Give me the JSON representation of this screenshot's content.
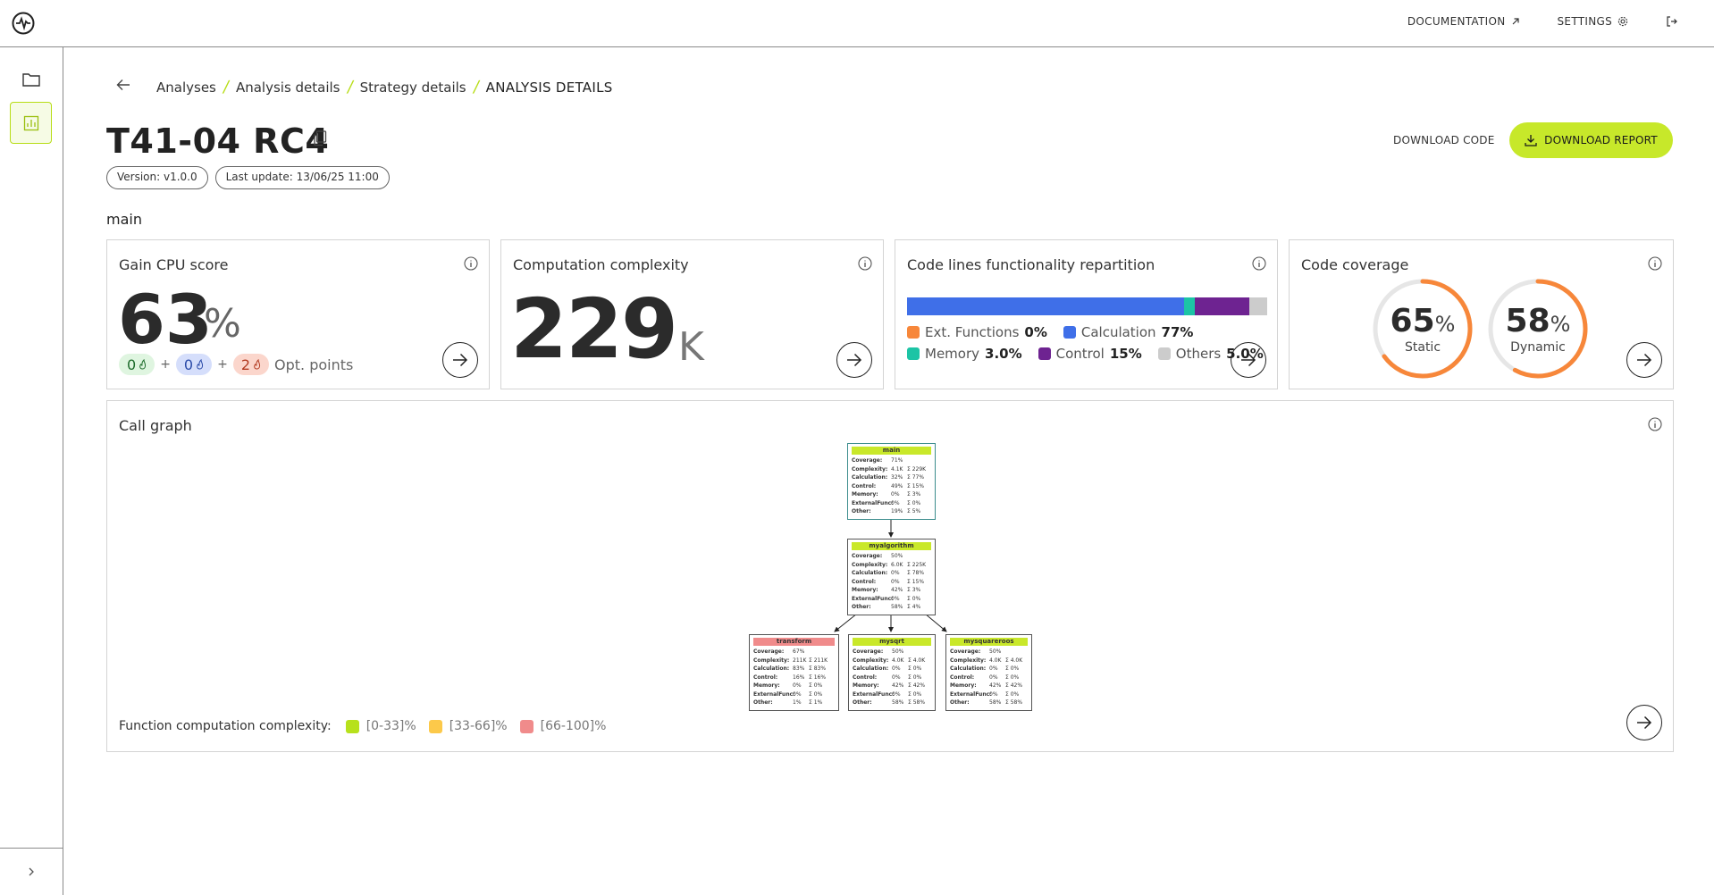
{
  "topbar": {
    "documentation_label": "DOCUMENTATION",
    "settings_label": "SETTINGS"
  },
  "breadcrumb": {
    "items": [
      "Analyses",
      "Analysis details",
      "Strategy details"
    ],
    "current": "ANALYSIS DETAILS"
  },
  "header": {
    "title": "T41-04 RC4",
    "version": "Version: v1.0.0",
    "last_update": "Last update: 13/06/25 11:00",
    "download_code_label": "DOWNLOAD CODE",
    "download_report_label": "DOWNLOAD REPORT"
  },
  "section": {
    "label": "main"
  },
  "cards": {
    "cpu": {
      "title": "Gain CPU score",
      "value": "63",
      "unit": "%",
      "opt_green": "0",
      "opt_blue": "0",
      "opt_red": "2",
      "plus": "+",
      "opt_label": "Opt. points"
    },
    "complexity": {
      "title": "Computation complexity",
      "value": "229",
      "unit": "K"
    },
    "repartition": {
      "title": "Code lines functionality repartition",
      "segments": [
        {
          "name": "Ext. Functions",
          "value_label": "0%",
          "fraction": 0.0,
          "color": "#f7873a"
        },
        {
          "name": "Calculation",
          "value_label": "77%",
          "fraction": 0.77,
          "color": "#3f6fe8"
        },
        {
          "name": "Memory",
          "value_label": "3.0%",
          "fraction": 0.03,
          "color": "#1cc4a5"
        },
        {
          "name": "Control",
          "value_label": "15%",
          "fraction": 0.15,
          "color": "#6e2391"
        },
        {
          "name": "Others",
          "value_label": "5.0%",
          "fraction": 0.05,
          "color": "#cccccc"
        }
      ]
    },
    "coverage": {
      "title": "Code coverage",
      "static_value": "65",
      "static_label": "Static",
      "static_fraction": 0.65,
      "dynamic_value": "58",
      "dynamic_label": "Dynamic",
      "dynamic_fraction": 0.58,
      "unit": "%",
      "color": "#f7873a"
    }
  },
  "callgraph": {
    "title": "Call graph",
    "legend_label": "Function computation complexity:",
    "legend": [
      {
        "label": "[0-33]%",
        "color": "#b7e11c"
      },
      {
        "label": "[33-66]%",
        "color": "#fcc94a"
      },
      {
        "label": "[66-100]%",
        "color": "#f08b8b"
      }
    ],
    "nodes": {
      "main": {
        "name": "main",
        "color": "#c9e82a",
        "rows": [
          [
            "Coverage:",
            "71%",
            ""
          ],
          [
            "Complexity:",
            "4.1K",
            "Σ 229K"
          ],
          [
            "Calculation:",
            "32%",
            "Σ 77%"
          ],
          [
            "Control:",
            "49%",
            "Σ 15%"
          ],
          [
            "Memory:",
            "0%",
            "Σ 3%"
          ],
          [
            "ExternalFunc:",
            "0%",
            "Σ 0%"
          ],
          [
            "Other:",
            "19%",
            "Σ 5%"
          ]
        ]
      },
      "myalgorithm": {
        "name": "myalgorithm",
        "color": "#c9e82a",
        "rows": [
          [
            "Coverage:",
            "50%",
            ""
          ],
          [
            "Complexity:",
            "6.0K",
            "Σ 225K"
          ],
          [
            "Calculation:",
            "0%",
            "Σ 78%"
          ],
          [
            "Control:",
            "0%",
            "Σ 15%"
          ],
          [
            "Memory:",
            "42%",
            "Σ 3%"
          ],
          [
            "ExternalFunc:",
            "0%",
            "Σ 0%"
          ],
          [
            "Other:",
            "58%",
            "Σ 4%"
          ]
        ]
      },
      "transform": {
        "name": "transform",
        "color": "#f08b8b",
        "rows": [
          [
            "Coverage:",
            "67%",
            ""
          ],
          [
            "Complexity:",
            "211K",
            "Σ 211K"
          ],
          [
            "Calculation:",
            "83%",
            "Σ 83%"
          ],
          [
            "Control:",
            "16%",
            "Σ 16%"
          ],
          [
            "Memory:",
            "0%",
            "Σ 0%"
          ],
          [
            "ExternalFunc:",
            "0%",
            "Σ 0%"
          ],
          [
            "Other:",
            "1%",
            "Σ 1%"
          ]
        ]
      },
      "mysqrt": {
        "name": "mysqrt",
        "color": "#c9e82a",
        "rows": [
          [
            "Coverage:",
            "50%",
            ""
          ],
          [
            "Complexity:",
            "4.0K",
            "Σ 4.0K"
          ],
          [
            "Calculation:",
            "0%",
            "Σ 0%"
          ],
          [
            "Control:",
            "0%",
            "Σ 0%"
          ],
          [
            "Memory:",
            "42%",
            "Σ 42%"
          ],
          [
            "ExternalFunc:",
            "0%",
            "Σ 0%"
          ],
          [
            "Other:",
            "58%",
            "Σ 58%"
          ]
        ]
      },
      "mysquareroos": {
        "name": "mysquareroos",
        "color": "#c9e82a",
        "rows": [
          [
            "Coverage:",
            "50%",
            ""
          ],
          [
            "Complexity:",
            "4.0K",
            "Σ 4.0K"
          ],
          [
            "Calculation:",
            "0%",
            "Σ 0%"
          ],
          [
            "Control:",
            "0%",
            "Σ 0%"
          ],
          [
            "Memory:",
            "42%",
            "Σ 42%"
          ],
          [
            "ExternalFunc:",
            "0%",
            "Σ 0%"
          ],
          [
            "Other:",
            "58%",
            "Σ 58%"
          ]
        ]
      }
    }
  },
  "icons": {
    "logo": "pulse-logo-icon",
    "external": "external-link-icon",
    "settings": "gear-icon",
    "logout": "logout-icon",
    "folder": "folder-icon",
    "report": "chart-report-icon",
    "expand": "chevron-right-icon",
    "back": "arrow-left-icon",
    "copy": "copy-icon",
    "download": "download-icon",
    "info": "info-icon",
    "arrow": "arrow-right-icon",
    "flame": "flame-icon"
  }
}
